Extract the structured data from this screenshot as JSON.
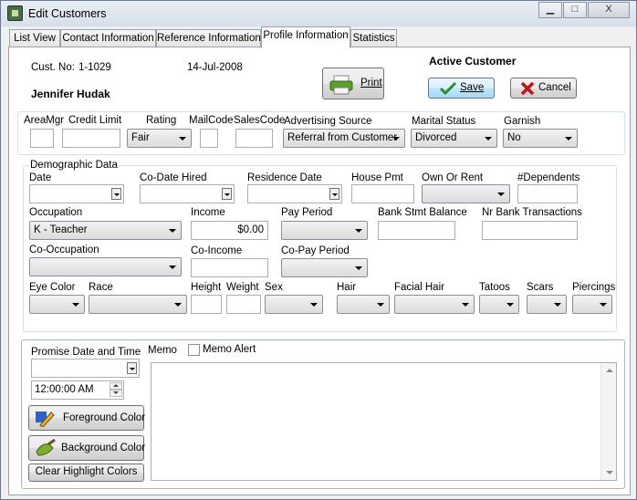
{
  "window": {
    "title": "Edit Customers",
    "minimize": "▁",
    "maximize": "□",
    "close": "X"
  },
  "tabs": [
    "List View",
    "Contact Information",
    "Reference Information",
    "Profile Information",
    "Statistics"
  ],
  "header": {
    "cust_no_label": "Cust. No:",
    "cust_no": "1-1029",
    "date": "14-Jul-2008",
    "name": "Jennifer Hudak",
    "print_label": "Print",
    "status": "Active Customer",
    "save_label": "Save",
    "cancel_label": "Cancel"
  },
  "credit": {
    "areamgr_label": "AreaMgr",
    "credit_limit_label": "Credit Limit",
    "rating_label": "Rating",
    "rating_value": "Fair",
    "mailcode_label": "MailCode",
    "salescode_label": "SalesCode",
    "ad_source_label": "Advertising Source",
    "ad_source_value": "Referral from Customer",
    "marital_label": "Marital Status",
    "marital_value": "Divorced",
    "garnish_label": "Garnish",
    "garnish_value": "No"
  },
  "demo": {
    "group_label": "Demographic Data",
    "date_label": "Date",
    "co_date_label": "Co-Date Hired",
    "residence_label": "Residence Date",
    "house_pmt_label": "House Pmt",
    "own_rent_label": "Own Or Rent",
    "dependents_label": "#Dependents",
    "occupation_label": "Occupation",
    "occupation_value": "K - Teacher",
    "income_label": "Income",
    "income_value": "$0.00",
    "pay_period_label": "Pay Period",
    "bank_balance_label": "Bank Stmt Balance",
    "nr_bank_label": "Nr Bank Transactions",
    "co_occupation_label": "Co-Occupation",
    "co_income_label": "Co-Income",
    "co_pay_label": "Co-Pay Period",
    "eye_label": "Eye Color",
    "race_label": "Race",
    "height_label": "Height",
    "weight_label": "Weight",
    "sex_label": "Sex",
    "hair_label": "Hair",
    "facial_label": "Facial Hair",
    "tatoos_label": "Tatoos",
    "scars_label": "Scars",
    "piercings_label": "Piercings"
  },
  "promise": {
    "label": "Promise Date and Time",
    "time_value": "12:00:00 AM",
    "memo_label": "Memo",
    "memo_alert_label": "Memo Alert",
    "fg_label": "Foreground Color",
    "bg_label": "Background Color",
    "clear_label": "Clear Highlight Colors"
  },
  "colors": {
    "save_check": "#2e8b2e",
    "cancel_x": "#c0141c",
    "page_bg": "#ffffff",
    "dialog_bg": "#f0f0f0"
  }
}
